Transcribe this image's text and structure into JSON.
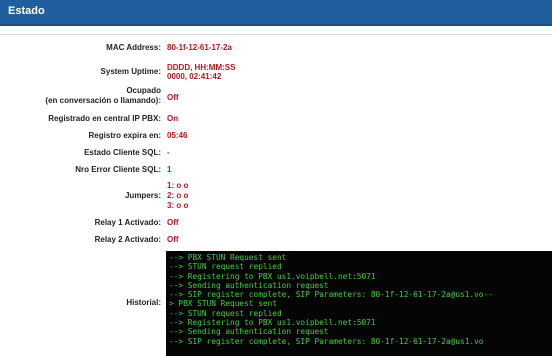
{
  "header": {
    "title": "Estado"
  },
  "colors": {
    "header_bg": "#1f5f9e",
    "value_red": "#c0141c",
    "terminal_bg": "#050505",
    "terminal_text": "#39d439"
  },
  "status": {
    "mac_label": "MAC Address:",
    "mac_value": "80-1f-12-61-17-2a",
    "uptime_label": "System Uptime:",
    "uptime_format": "DDDD, HH:MM:SS",
    "uptime_value": "0000, 02:41:42",
    "busy_label_1": "Ocupado",
    "busy_label_2": "(en conversación o llamando):",
    "busy_value": "Off",
    "pbx_label": "Registrado en central IP PBX:",
    "pbx_value": "On",
    "expiry_label": "Registro expira en:",
    "expiry_value": "05:46",
    "sql_state_label": "Estado Cliente SQL:",
    "sql_state_value": "-",
    "sql_err_label": "Nro Error Cliente SQL:",
    "sql_err_value": "1",
    "jumpers_label": "Jumpers:",
    "jumpers": [
      "1: o o",
      "2: o o",
      "3: o o"
    ],
    "relay1_label": "Relay 1 Activado:",
    "relay1_value": "Off",
    "relay2_label": "Relay 2 Activado:",
    "relay2_value": "Off",
    "history_label": "Historial:"
  },
  "history": [
    "--> PBX STUN Request sent",
    "--> STUN request replied",
    "--> Registering to PBX us1.voipbell.net:5071",
    "--> Sending authentication request",
    "--> SIP register complete, SIP Parameters: 80-1f-12-61-17-2a@us1.vo--",
    "> PBX STUN Request sent",
    "--> STUN request replied",
    "--> Registering to PBX us1.voipbell.net:5071",
    "--> Sending authentication request",
    "--> SIP register complete, SIP Parameters: 80-1f-12-61-17-2a@us1.vo"
  ]
}
